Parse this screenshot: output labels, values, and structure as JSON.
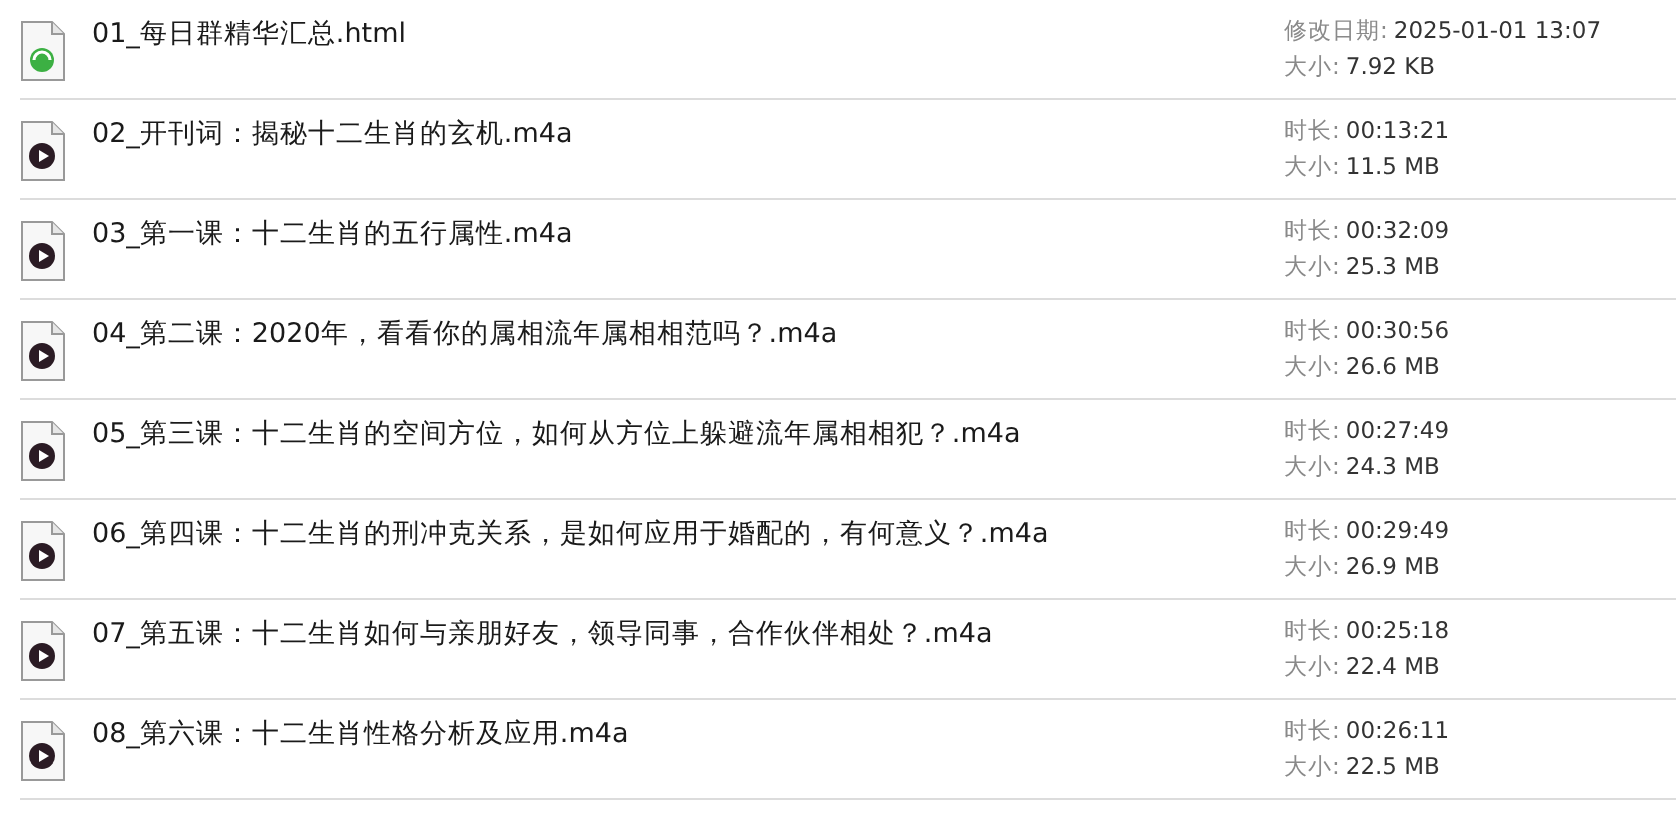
{
  "files": [
    {
      "kind": "html",
      "name": "01_每日群精华汇总.html",
      "meta": [
        {
          "label": "修改日期:",
          "value": "2025-01-01 13:07"
        },
        {
          "label": "大小:",
          "value": "7.92 KB"
        }
      ]
    },
    {
      "kind": "audio",
      "name": "02_开刊词：揭秘十二生肖的玄机.m4a",
      "meta": [
        {
          "label": "时长:",
          "value": "00:13:21"
        },
        {
          "label": "大小:",
          "value": "11.5 MB"
        }
      ]
    },
    {
      "kind": "audio",
      "name": "03_第一课：十二生肖的五行属性.m4a",
      "meta": [
        {
          "label": "时长:",
          "value": "00:32:09"
        },
        {
          "label": "大小:",
          "value": "25.3 MB"
        }
      ]
    },
    {
      "kind": "audio",
      "name": "04_第二课：2020年，看看你的属相流年属相相范吗？.m4a",
      "meta": [
        {
          "label": "时长:",
          "value": "00:30:56"
        },
        {
          "label": "大小:",
          "value": "26.6 MB"
        }
      ]
    },
    {
      "kind": "audio",
      "name": "05_第三课：十二生肖的空间方位，如何从方位上躲避流年属相相犯？.m4a",
      "meta": [
        {
          "label": "时长:",
          "value": "00:27:49"
        },
        {
          "label": "大小:",
          "value": "24.3 MB"
        }
      ]
    },
    {
      "kind": "audio",
      "name": "06_第四课：十二生肖的刑冲克关系，是如何应用于婚配的，有何意义？.m4a",
      "meta": [
        {
          "label": "时长:",
          "value": "00:29:49"
        },
        {
          "label": "大小:",
          "value": "26.9 MB"
        }
      ]
    },
    {
      "kind": "audio",
      "name": "07_第五课：十二生肖如何与亲朋好友，领导同事，合作伙伴相处？.m4a",
      "meta": [
        {
          "label": "时长:",
          "value": "00:25:18"
        },
        {
          "label": "大小:",
          "value": "22.4 MB"
        }
      ]
    },
    {
      "kind": "audio",
      "name": "08_第六课：十二生肖性格分析及应用.m4a",
      "meta": [
        {
          "label": "时长:",
          "value": "00:26:11"
        },
        {
          "label": "大小:",
          "value": "22.5 MB"
        }
      ]
    }
  ]
}
